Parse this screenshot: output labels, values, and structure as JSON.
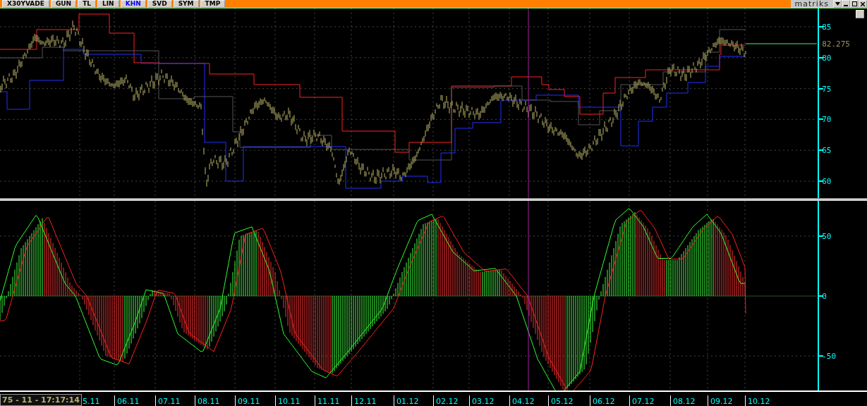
{
  "toolbar": {
    "tabs": [
      {
        "label": "X30YVADE",
        "selected": false
      },
      {
        "label": "GUN",
        "selected": false
      },
      {
        "label": "TL",
        "selected": false
      },
      {
        "label": "LIN",
        "selected": false
      },
      {
        "label": "KHN",
        "selected": true
      },
      {
        "label": "SVD",
        "selected": false
      },
      {
        "label": "SYM",
        "selected": false
      },
      {
        "label": "TMP",
        "selected": false
      }
    ],
    "logo": "matriks"
  },
  "price_panel": {
    "y_axis": [
      "85",
      "80",
      "75",
      "70",
      "65",
      "60"
    ],
    "last_price": "82.275"
  },
  "oscillator_panel": {
    "y_axis": [
      "50",
      "0",
      "-50"
    ]
  },
  "time_axis": {
    "status": "75 - 11 - 17:17:14",
    "dates": [
      "5.11",
      "06.11",
      "07.11",
      "08.11",
      "09.11",
      "10.11",
      "11.11",
      "12.11",
      "01.12",
      "02.12",
      "03.12",
      "04.12",
      "05.12",
      "06.12",
      "07.12",
      "08.12",
      "09.12",
      "10.12"
    ]
  }
}
